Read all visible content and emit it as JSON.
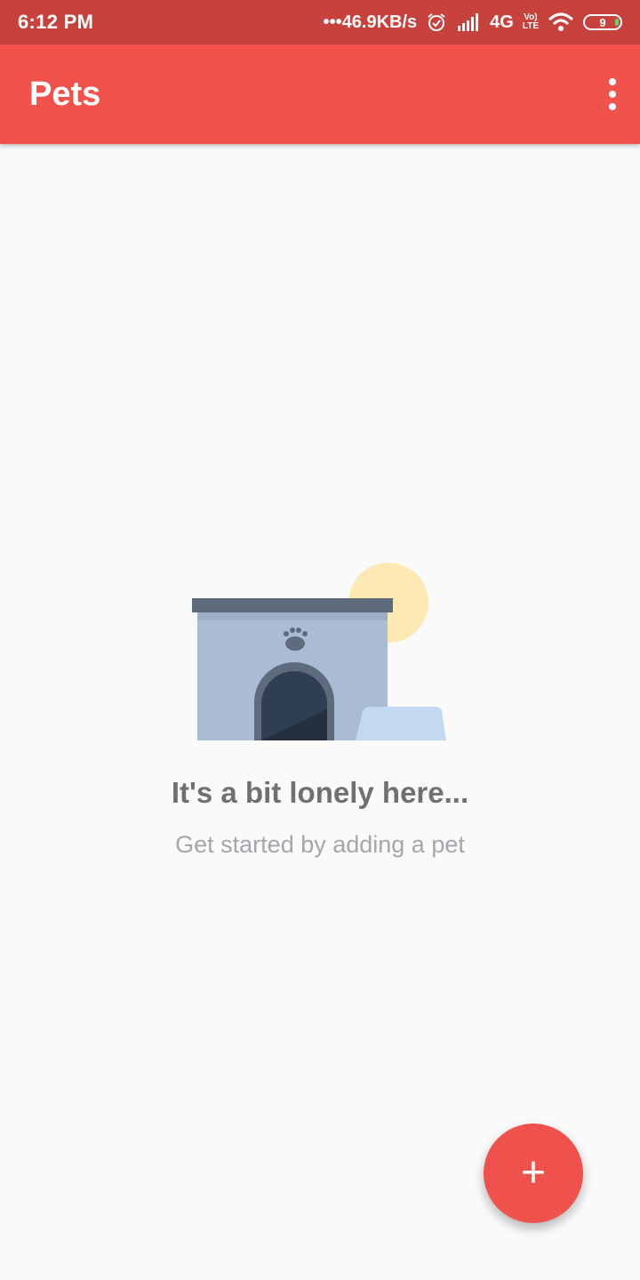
{
  "status_bar": {
    "time": "6:12 PM",
    "network_speed": "46.9KB/s",
    "network_type": "4G",
    "volte_top": "Vo)",
    "volte_bottom": "LTE",
    "battery_level": "9",
    "icons": [
      "alarm-icon",
      "signal-icon",
      "wifi-icon",
      "battery-icon"
    ]
  },
  "app_bar": {
    "title": "Pets",
    "menu_icon": "more-vert-icon"
  },
  "empty_state": {
    "title": "It's a bit lonely here...",
    "subtitle": "Get started by adding a pet",
    "illustration": "pet-house-illustration"
  },
  "fab": {
    "label": "+",
    "icon": "add-icon"
  },
  "colors": {
    "status_bar": "#c7413d",
    "app_bar": "#f1524c",
    "fab": "#ef514c",
    "background": "#fafafa",
    "title_text": "#707070",
    "subtitle_text": "#a3a6ab"
  }
}
